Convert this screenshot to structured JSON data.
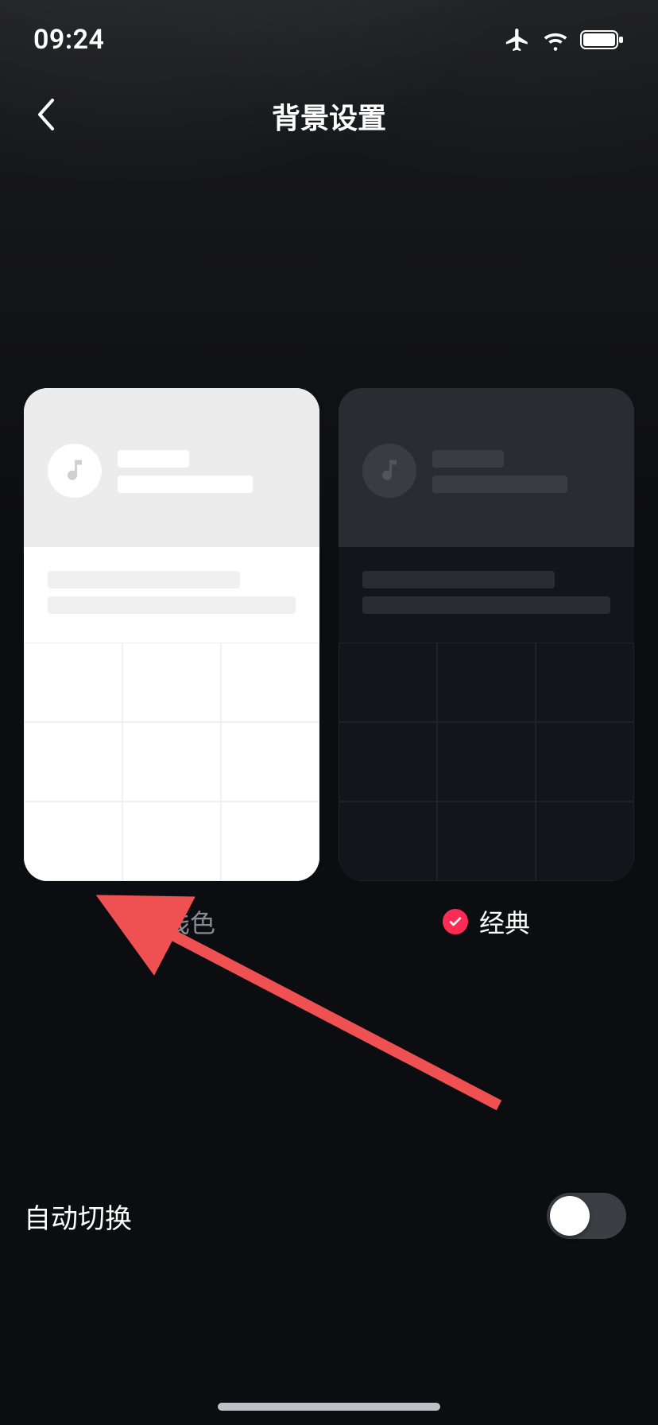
{
  "status": {
    "time": "09:24"
  },
  "nav": {
    "title": "背景设置"
  },
  "options": {
    "light": {
      "label": "浅色",
      "selected": false
    },
    "classic": {
      "label": "经典",
      "selected": true
    }
  },
  "auto_switch": {
    "label": "自动切换",
    "enabled": false
  },
  "colors": {
    "accent": "#fe2c55"
  }
}
